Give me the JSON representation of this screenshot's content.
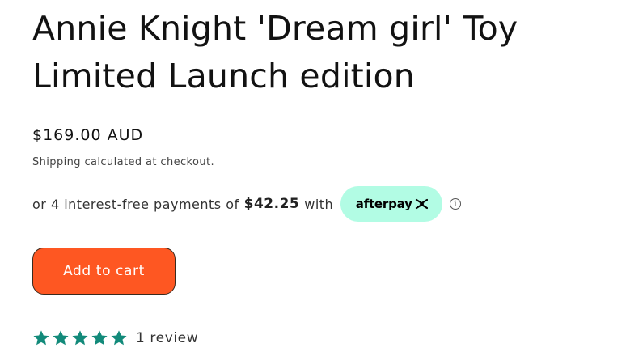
{
  "product": {
    "title_line1": "Annie Knight 'Dream girl' Toy",
    "title_line2": "Limited Launch edition",
    "price": "$169.00 AUD",
    "shipping_link": "Shipping",
    "shipping_suffix": " calculated at checkout."
  },
  "afterpay": {
    "prefix": "or 4 interest-free payments of",
    "amount": "$42.25",
    "suffix": "with",
    "brand": "afterpay",
    "info_glyph": "i",
    "badge_color": "#b2fce4"
  },
  "cart": {
    "button_label": "Add to cart",
    "button_color": "#fe5722"
  },
  "reviews": {
    "rating": 5,
    "max_rating": 5,
    "count_text": "1 review",
    "star_color": "#128a7a"
  }
}
